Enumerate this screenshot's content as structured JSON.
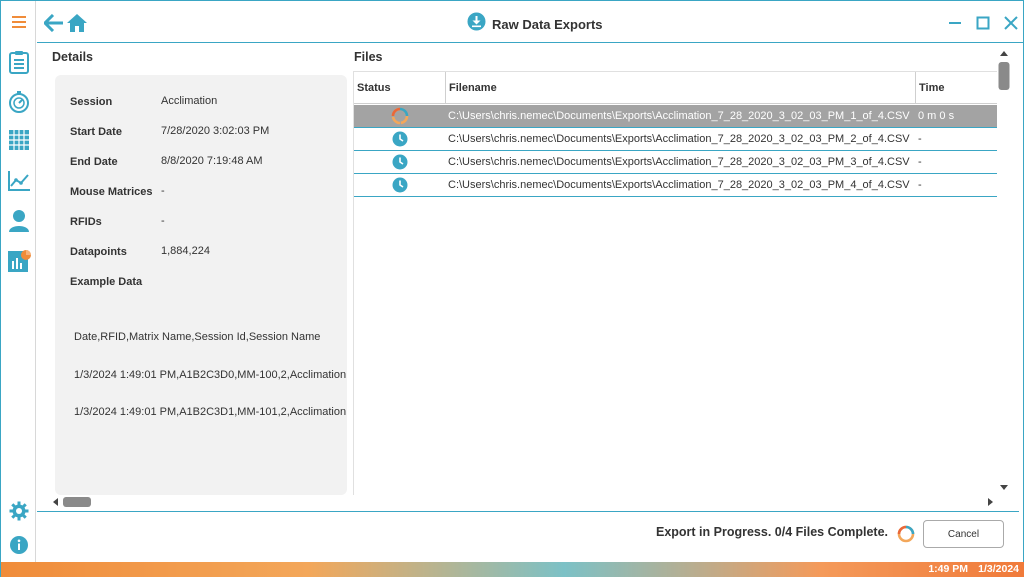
{
  "window": {
    "title": "Raw Data Exports"
  },
  "colors": {
    "accent": "#3aa6c4",
    "orange": "#f08c3a",
    "selected_row": "#a3a3a3"
  },
  "sidebar": {
    "items": [
      {
        "icon": "menu-icon"
      },
      {
        "icon": "clipboard-icon"
      },
      {
        "icon": "stopwatch-icon"
      },
      {
        "icon": "grid-icon"
      },
      {
        "icon": "line-chart-icon"
      },
      {
        "icon": "user-icon"
      },
      {
        "icon": "report-icon"
      },
      {
        "icon": "gear-icon"
      },
      {
        "icon": "info-icon"
      }
    ]
  },
  "details": {
    "header": "Details",
    "rows": [
      {
        "label": "Session",
        "value": "Acclimation"
      },
      {
        "label": "Start Date",
        "value": "7/28/2020 3:02:03 PM"
      },
      {
        "label": "End Date",
        "value": "8/8/2020 7:19:48 AM"
      },
      {
        "label": "Mouse Matrices",
        "value": "-"
      },
      {
        "label": "RFIDs",
        "value": "-"
      },
      {
        "label": "Datapoints",
        "value": "1,884,224"
      }
    ],
    "example_label": "Example Data",
    "example_lines": [
      "Date,RFID,Matrix Name,Session Id,Session Name",
      "1/3/2024 1:49:01 PM,A1B2C3D0,MM-100,2,Acclimation",
      "1/3/2024 1:49:01 PM,A1B2C3D1,MM-101,2,Acclimation"
    ]
  },
  "files": {
    "header": "Files",
    "columns": [
      "Status",
      "Filename",
      "Time"
    ],
    "rows": [
      {
        "status": "in-progress",
        "filename": "C:\\Users\\chris.nemec\\Documents\\Exports\\Acclimation_7_28_2020_3_02_03_PM_1_of_4.CSV",
        "time": "0 m 0 s"
      },
      {
        "status": "pending",
        "filename": "C:\\Users\\chris.nemec\\Documents\\Exports\\Acclimation_7_28_2020_3_02_03_PM_2_of_4.CSV",
        "time": "-"
      },
      {
        "status": "pending",
        "filename": "C:\\Users\\chris.nemec\\Documents\\Exports\\Acclimation_7_28_2020_3_02_03_PM_3_of_4.CSV",
        "time": "-"
      },
      {
        "status": "pending",
        "filename": "C:\\Users\\chris.nemec\\Documents\\Exports\\Acclimation_7_28_2020_3_02_03_PM_4_of_4.CSV",
        "time": "-"
      }
    ]
  },
  "footer": {
    "status_text": "Export in Progress. 0/4 Files Complete.",
    "cancel_label": "Cancel"
  },
  "taskbar": {
    "time": "1:49 PM",
    "date": "1/3/2024"
  }
}
